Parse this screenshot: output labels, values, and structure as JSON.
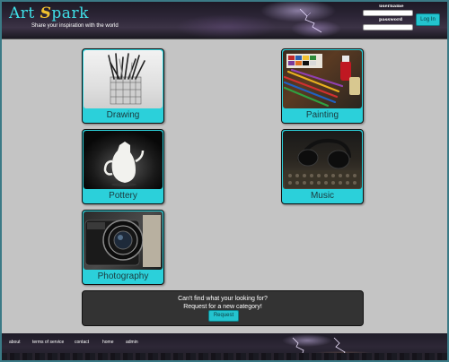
{
  "header": {
    "logo_prefix": "Art ",
    "logo_s": "S",
    "logo_suffix": "park",
    "tagline": "Share your inspiration with the world"
  },
  "login": {
    "username_label": "username",
    "password_label": "password",
    "username_value": "",
    "password_value": "",
    "button_label": "Log In"
  },
  "categories": [
    {
      "label": "Drawing"
    },
    {
      "label": "Painting"
    },
    {
      "label": "Pottery"
    },
    {
      "label": "Music"
    },
    {
      "label": "Photography"
    }
  ],
  "request": {
    "line1": "Can't find what your looking for?",
    "line2": "Request for a new category!",
    "button_label": "Request"
  },
  "footer": {
    "links": [
      "about",
      "terms of service",
      "contact",
      "home",
      "admin"
    ]
  },
  "colors": {
    "accent": "#2bd0da",
    "logo": "#3fe0e8",
    "logo_s": "#f2c12e"
  }
}
